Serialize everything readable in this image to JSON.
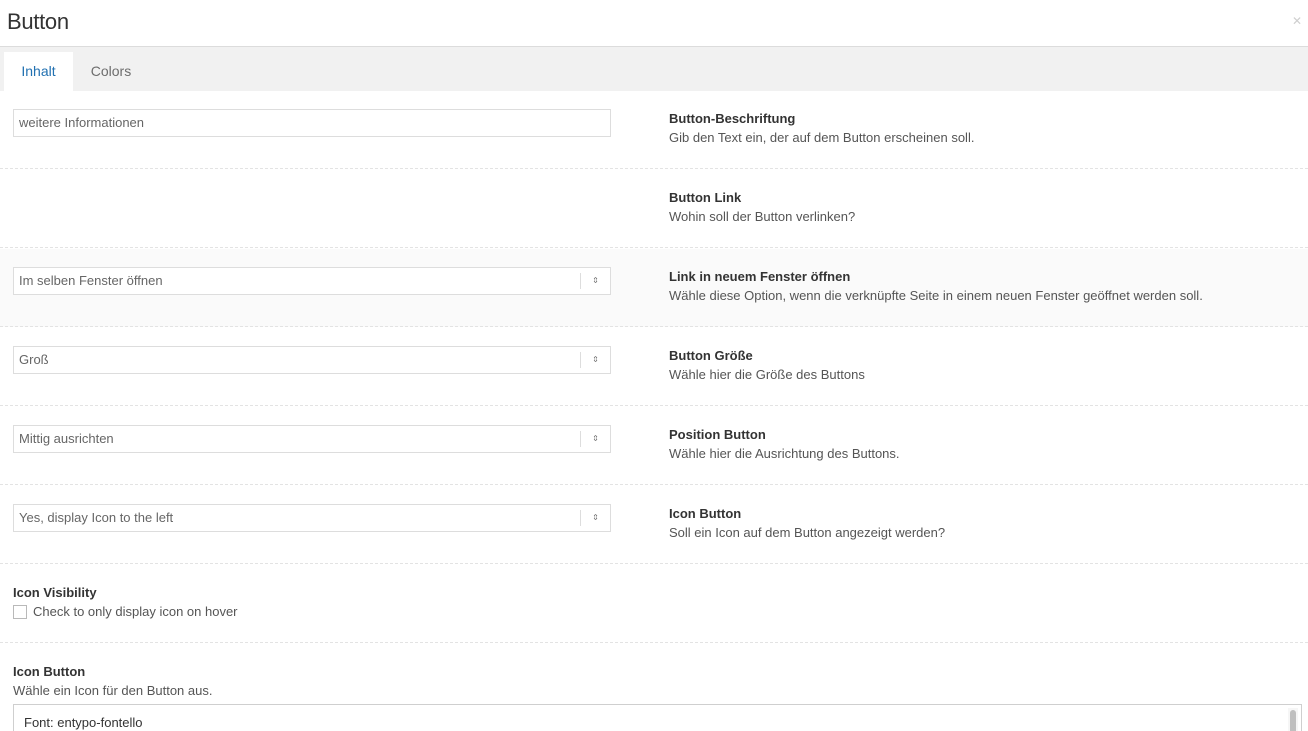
{
  "header": {
    "title": "Button",
    "close_icon": "close-icon"
  },
  "tabs": [
    {
      "label": "Inhalt",
      "active": true
    },
    {
      "label": "Colors",
      "active": false
    }
  ],
  "fields": {
    "label": {
      "value": "weitere Informationen",
      "title": "Button-Beschriftung",
      "description": "Gib den Text ein, der auf dem Button erscheinen soll."
    },
    "link": {
      "title": "Button Link",
      "description": "Wohin soll der Button verlinken?"
    },
    "target": {
      "value": "Im selben Fenster öffnen",
      "title": "Link in neuem Fenster öffnen",
      "description": "Wähle diese Option, wenn die verknüpfte Seite in einem neuen Fenster geöffnet werden soll."
    },
    "size": {
      "value": "Groß",
      "title": "Button Größe",
      "description": "Wähle hier die Größe des Buttons"
    },
    "position": {
      "value": "Mittig ausrichten",
      "title": "Position Button",
      "description": "Wähle hier die Ausrichtung des Buttons."
    },
    "icon_select": {
      "value": "Yes, display Icon to the left",
      "title": "Icon Button",
      "description": "Soll ein Icon auf dem Button angezeigt werden?"
    },
    "icon_visibility": {
      "title": "Icon Visibility",
      "checkbox_label": "Check to only display icon on hover",
      "checked": false
    },
    "icon_picker": {
      "title": "Icon Button",
      "description": "Wähle ein Icon für den Button aus.",
      "font_label": "Font: entypo-fontello"
    }
  },
  "select_arrow_glyph": "⇕",
  "accent_color": "#2271b1"
}
